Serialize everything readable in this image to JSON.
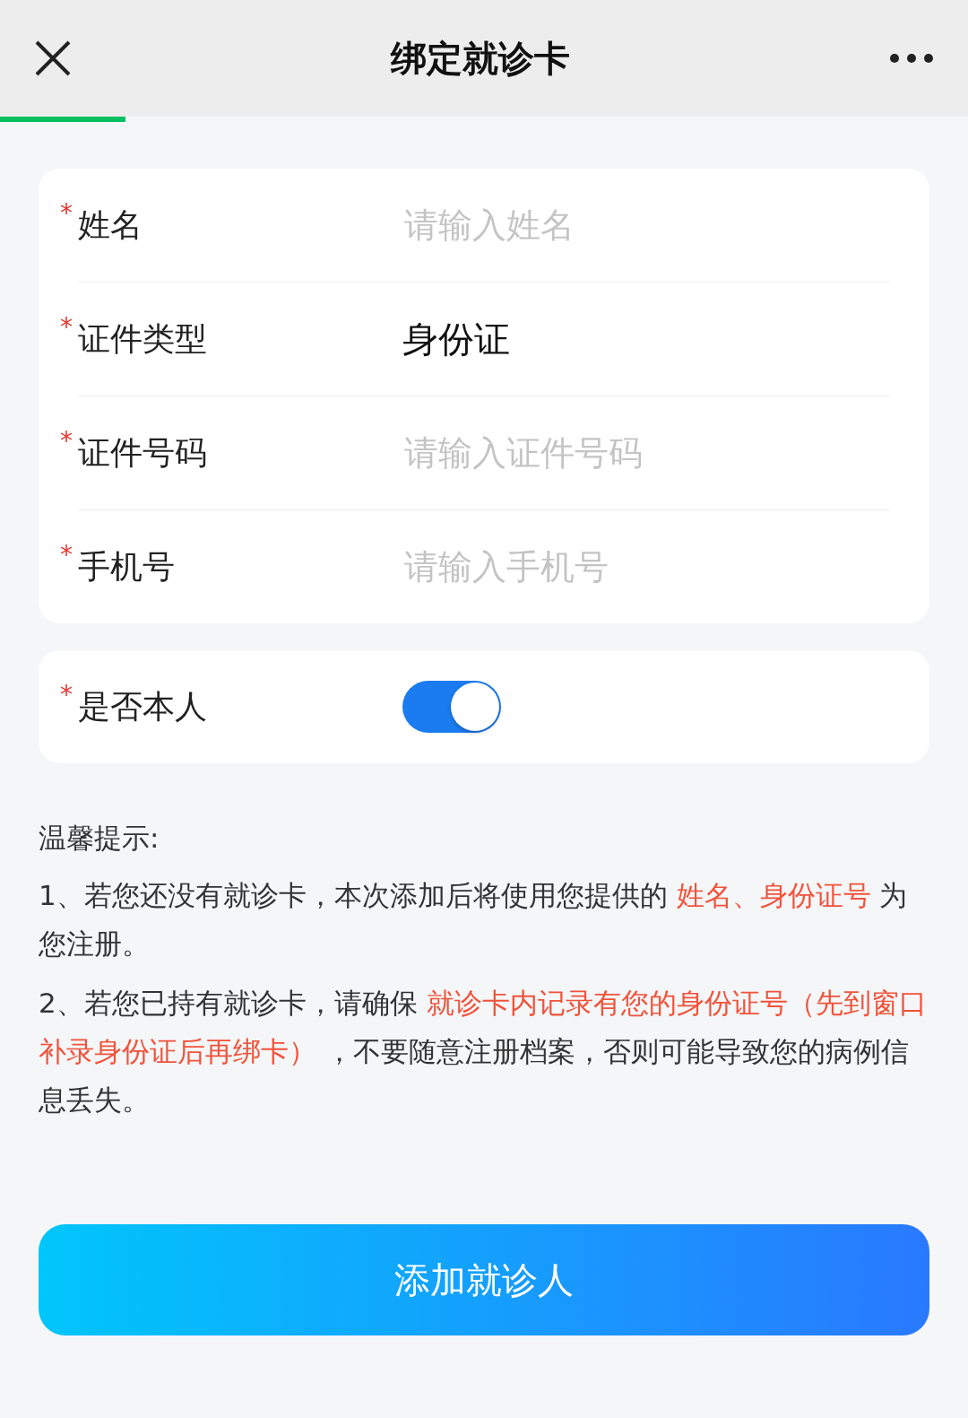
{
  "header": {
    "title": "绑定就诊卡"
  },
  "progress": {
    "level": 0.13
  },
  "form": {
    "fields": [
      {
        "kind": "input",
        "required_mark": "*",
        "label": "姓名",
        "placeholder": "请输入姓名"
      },
      {
        "kind": "select",
        "required_mark": "*",
        "label": "证件类型",
        "value": "身份证"
      },
      {
        "kind": "input",
        "required_mark": "*",
        "label": "证件号码",
        "placeholder": "请输入证件号码"
      },
      {
        "kind": "input",
        "required_mark": "*",
        "label": "手机号",
        "placeholder": "请输入手机号"
      }
    ]
  },
  "self_toggle": {
    "required_mark": "*",
    "label": "是否本人",
    "on": true
  },
  "tips": {
    "title": "温馨提示:",
    "items": [
      {
        "segments": [
          {
            "text": "1、若您还没有就诊卡，本次添加后将使用您提供的 ",
            "highlight": false
          },
          {
            "text": "姓名、身份证号",
            "highlight": true
          },
          {
            "text": " 为您注册。",
            "highlight": false
          }
        ]
      },
      {
        "segments": [
          {
            "text": "2、若您已持有就诊卡，请确保 ",
            "highlight": false
          },
          {
            "text": "就诊卡内记录有您的身份证号（先到窗口补录身份证后再绑卡）",
            "highlight": true
          },
          {
            "text": " ，不要随意注册档案，否则可能导致您的病例信息丢失。",
            "highlight": false
          }
        ]
      }
    ]
  },
  "submit_button": "添加就诊人"
}
